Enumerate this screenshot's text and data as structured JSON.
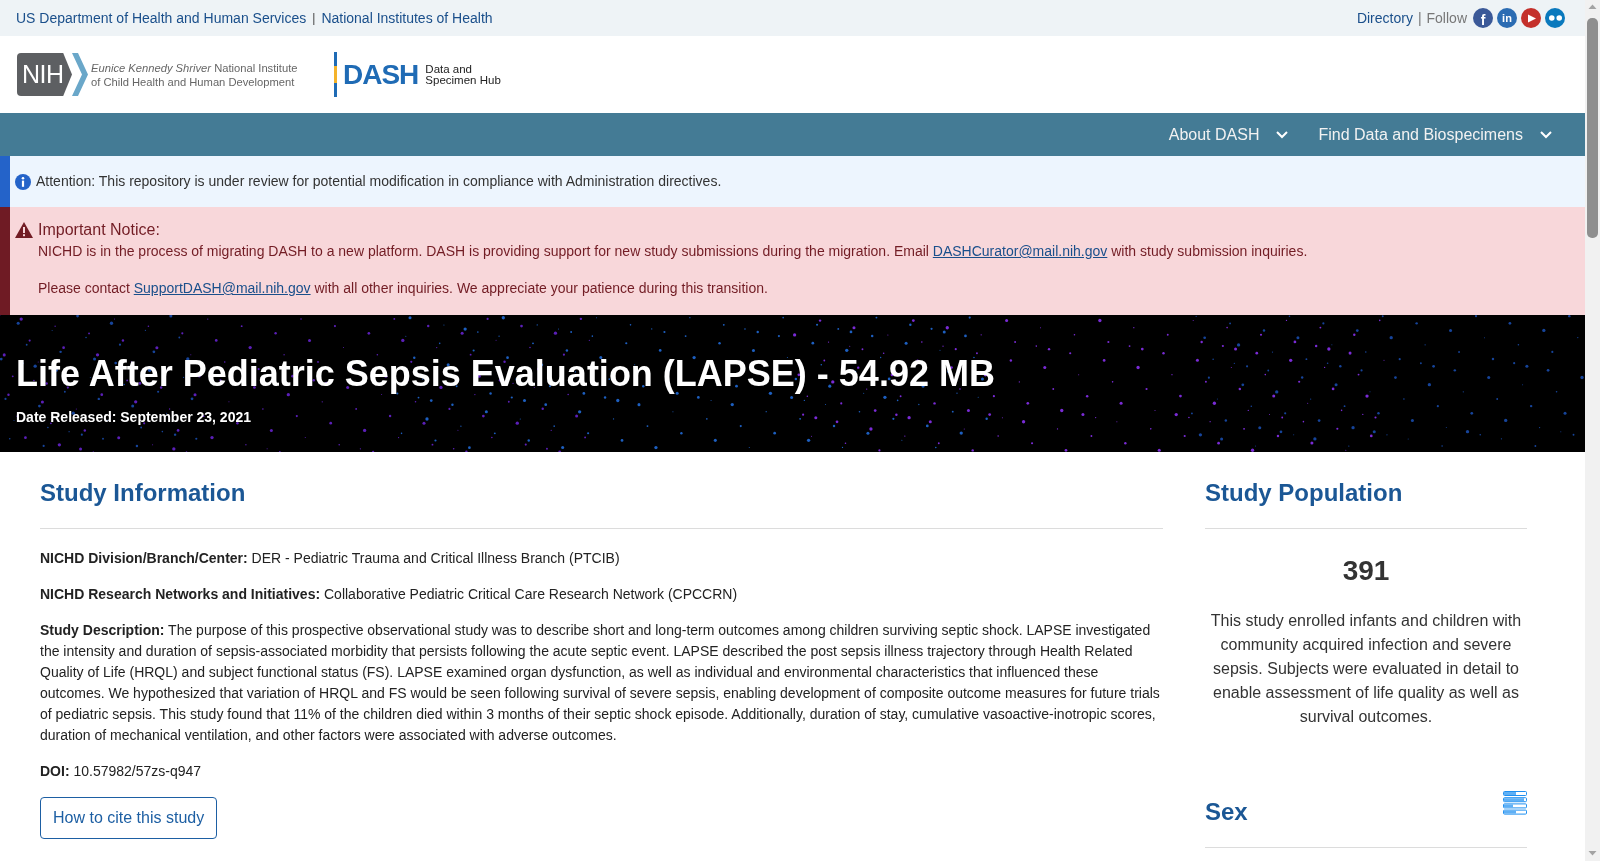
{
  "top_bar": {
    "agency_links": [
      {
        "label": "US Department of Health and Human Services"
      },
      {
        "label": "National Institutes of Health"
      }
    ],
    "agency_separator": "|",
    "directory_link": "Directory",
    "follow_separator": "|",
    "follow_label": "Follow",
    "social_links": [
      {
        "kind": "facebook",
        "glyph": "f"
      },
      {
        "kind": "linkedin",
        "glyph": "in"
      },
      {
        "kind": "youtube"
      },
      {
        "kind": "flickr"
      }
    ]
  },
  "header": {
    "nih_badge": "NIH",
    "institute_name": "*Eunice Kennedy Shriver* National Institute of Child Health and Human Development",
    "dash_wordmark": "DASH",
    "dash_tagline": "Data and Specimen Hub"
  },
  "nav": {
    "items": [
      {
        "label": "About DASH",
        "expanded": false
      },
      {
        "label": "Find Data and Biospecimens",
        "expanded": false
      }
    ]
  },
  "alerts": [
    {
      "kind": "info",
      "paragraphs": [
        [
          {
            "text": "Attention: This repository is under review for potential modification in compliance with Administration directives."
          }
        ]
      ]
    },
    {
      "kind": "warning",
      "title": "Important Notice:",
      "paragraphs": [
        [
          {
            "text": "NICHD is in the process of migrating DASH to a new platform. DASH is providing support for new study submissions during the migration. Email "
          },
          {
            "link": "DASHCurator@mail.nih.gov"
          },
          {
            "text": " with study submission inquiries."
          }
        ],
        [
          {
            "text": "Please contact "
          },
          {
            "link": "SupportDASH@mail.nih.gov"
          },
          {
            "text": " with all other inquiries. We appreciate your patience during this transition."
          }
        ]
      ]
    }
  ],
  "study": {
    "title": "Life After Pediatric Sepsis Evaluation (LAPSE) - 54.92 MB",
    "date_released": "Date Released: September 23, 2021"
  },
  "study_information": {
    "heading": "Study Information",
    "fields": [
      "**NICHD Division/Branch/Center:** DER - Pediatric Trauma and Critical Illness Branch (PTCIB)",
      "**NICHD Research Networks and Initiatives:** Collaborative Pediatric Critical Care Research Network (CPCCRN)",
      "**Study Description:** The purpose of this prospective observational study was to describe short and long-term outcomes among children surviving septic shock. LAPSE investigated the intensity and duration of sepsis-associated morbidity that persists following the acute septic event. LAPSE described the post sepsis illness trajectory through Health Related Quality of Life (HRQL) and subject functional status (FS). LAPSE examined organ dysfunction, as well as individual and environmental characteristics that influenced these outcomes. We hypothesized that variation of HRQL and FS would be seen following survival of severe sepsis, enabling development of composite outcome measures for future trials of pediatric sepsis. This study found that 11% of the children died within 3 months of their septic shock episode. Additionally, duration of stay, cumulative vasoactive-inotropic scores, duration of mechanical ventilation, and other factors were associated with adverse outcomes.",
      "**DOI:** 10.57982/57zs-q947"
    ],
    "cite_button": "How to cite this study"
  },
  "study_population": {
    "heading": "Study Population",
    "count": "391",
    "description": "This study enrolled infants and children with community acquired infection and severe sepsis. Subjects were evaluated in detail to enable assessment of life quality as well as survival outcomes."
  },
  "sex": {
    "heading": "Sex"
  }
}
